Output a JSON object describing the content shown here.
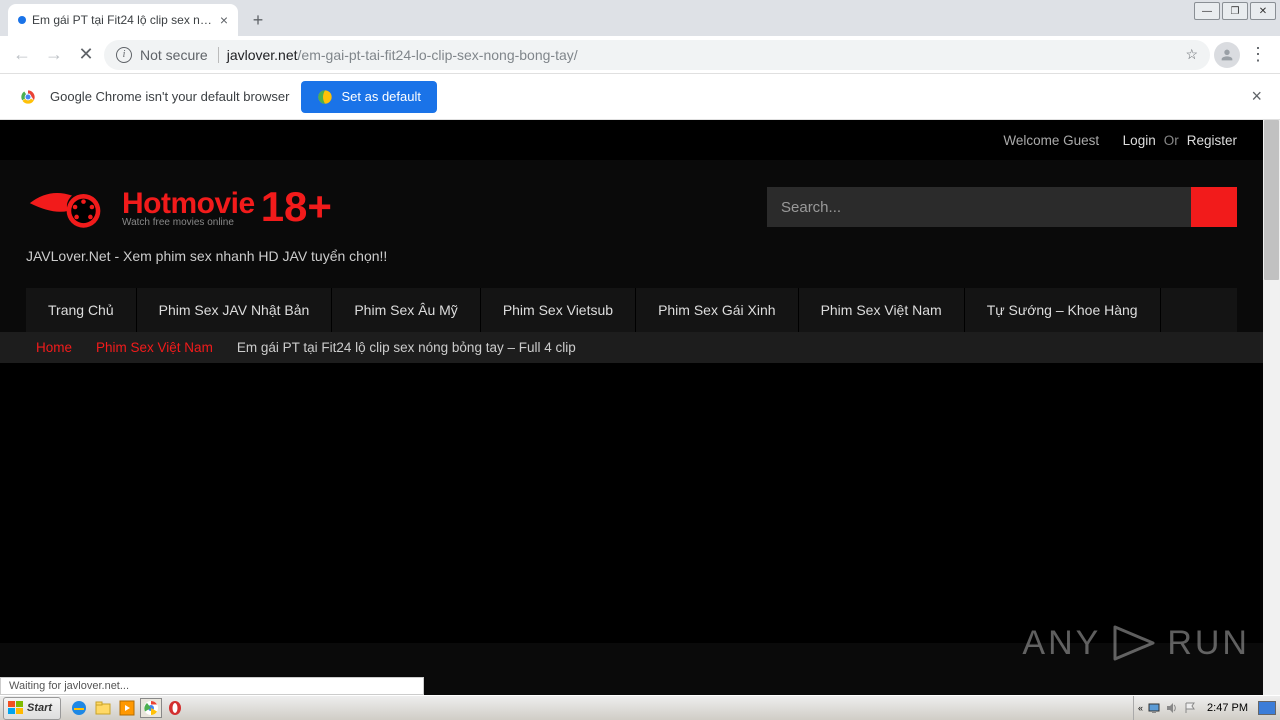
{
  "browser": {
    "tab_title": "Em gái PT tại Fit24 lộ clip sex nóng b",
    "not_secure": "Not secure",
    "url_domain": "javlover.net",
    "url_path": "/em-gai-pt-tai-fit24-lo-clip-sex-nong-bong-tay/"
  },
  "infobar": {
    "text": "Google Chrome isn't your default browser",
    "button": "Set as default"
  },
  "topbar": {
    "welcome": "Welcome Guest",
    "login": "Login",
    "or": "Or",
    "register": "Register"
  },
  "logo": {
    "main": "Hotmovie",
    "sub": "Watch free movies online",
    "suffix": "18+"
  },
  "tagline": "JAVLover.Net - Xem phim sex nhanh HD JAV tuyển chọn!!",
  "search": {
    "placeholder": "Search..."
  },
  "nav": {
    "items": [
      "Trang Chủ",
      "Phim Sex JAV Nhật Bản",
      "Phim Sex Âu Mỹ",
      "Phim Sex Vietsub",
      "Phim Sex Gái Xinh",
      "Phim Sex Việt Nam",
      "Tự Sướng – Khoe Hàng"
    ]
  },
  "breadcrumb": {
    "home": "Home",
    "cat": "Phim Sex Việt Nam",
    "title": "Em gái PT tại Fit24 lộ clip sex nóng bỏng tay – Full 4 clip"
  },
  "watermark": {
    "left": "ANY",
    "right": "RUN"
  },
  "status": "Waiting for javlover.net...",
  "taskbar": {
    "start": "Start",
    "clock": "2:47 PM"
  }
}
